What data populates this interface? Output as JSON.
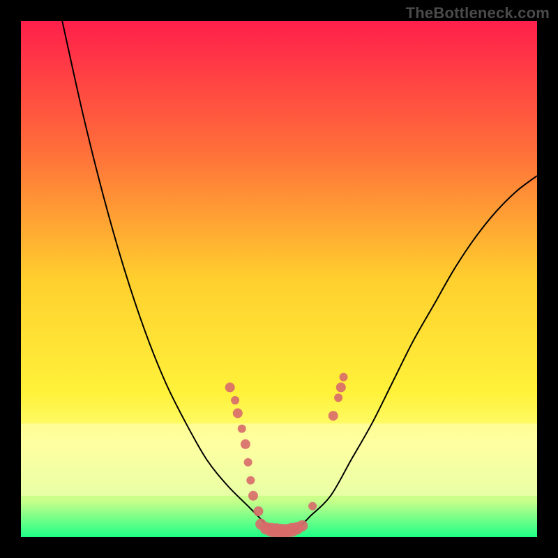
{
  "watermark": "TheBottleneck.com",
  "chart_data": {
    "type": "line",
    "title": "",
    "xlabel": "",
    "ylabel": "",
    "xlim": [
      0,
      100
    ],
    "ylim": [
      0,
      100
    ],
    "background_gradient": {
      "stops": [
        {
          "offset": 0.0,
          "color": "#ff1f4b"
        },
        {
          "offset": 0.25,
          "color": "#ff6e3a"
        },
        {
          "offset": 0.5,
          "color": "#ffcf2e"
        },
        {
          "offset": 0.72,
          "color": "#fff23a"
        },
        {
          "offset": 0.82,
          "color": "#fdff7e"
        },
        {
          "offset": 0.93,
          "color": "#c7ff8a"
        },
        {
          "offset": 1.0,
          "color": "#1fff87"
        }
      ]
    },
    "pale_band": {
      "y_from": 78,
      "y_to": 92,
      "color": "#ffffbe",
      "opacity": 0.55
    },
    "series": [
      {
        "name": "bottleneck-curve",
        "color": "#000000",
        "width": 2,
        "x": [
          8,
          12,
          16,
          20,
          24,
          28,
          32,
          36,
          40,
          44,
          46,
          48,
          50,
          52,
          54,
          56,
          60,
          64,
          68,
          72,
          76,
          80,
          84,
          88,
          92,
          96,
          100
        ],
        "y": [
          0,
          18,
          34,
          48,
          60,
          70,
          78,
          85,
          90,
          94,
          96,
          98,
          99,
          99,
          98,
          96,
          92,
          85,
          78,
          70,
          62,
          55,
          48,
          42,
          37,
          33,
          30
        ]
      }
    ],
    "scatter": {
      "name": "data-points",
      "color": "#d86a6a",
      "radius_min": 5,
      "radius_max": 11,
      "points": [
        {
          "x": 40.5,
          "y": 71.0,
          "r": 7
        },
        {
          "x": 41.5,
          "y": 73.5,
          "r": 6
        },
        {
          "x": 42.0,
          "y": 76.0,
          "r": 7
        },
        {
          "x": 42.8,
          "y": 79.0,
          "r": 6
        },
        {
          "x": 43.5,
          "y": 82.0,
          "r": 7
        },
        {
          "x": 44.0,
          "y": 85.5,
          "r": 6
        },
        {
          "x": 44.5,
          "y": 89.0,
          "r": 6
        },
        {
          "x": 45.0,
          "y": 92.0,
          "r": 7
        },
        {
          "x": 46.0,
          "y": 95.0,
          "r": 7
        },
        {
          "x": 46.5,
          "y": 97.5,
          "r": 8
        },
        {
          "x": 47.5,
          "y": 98.3,
          "r": 9
        },
        {
          "x": 48.5,
          "y": 98.6,
          "r": 10
        },
        {
          "x": 49.5,
          "y": 98.8,
          "r": 11
        },
        {
          "x": 50.5,
          "y": 98.9,
          "r": 11
        },
        {
          "x": 51.5,
          "y": 98.8,
          "r": 10
        },
        {
          "x": 52.5,
          "y": 98.6,
          "r": 10
        },
        {
          "x": 53.5,
          "y": 98.3,
          "r": 9
        },
        {
          "x": 54.5,
          "y": 97.8,
          "r": 8
        },
        {
          "x": 56.5,
          "y": 94.0,
          "r": 6
        },
        {
          "x": 60.5,
          "y": 76.5,
          "r": 7
        },
        {
          "x": 61.5,
          "y": 73.0,
          "r": 6
        },
        {
          "x": 62.0,
          "y": 71.0,
          "r": 7
        },
        {
          "x": 62.5,
          "y": 69.0,
          "r": 6
        }
      ]
    }
  }
}
